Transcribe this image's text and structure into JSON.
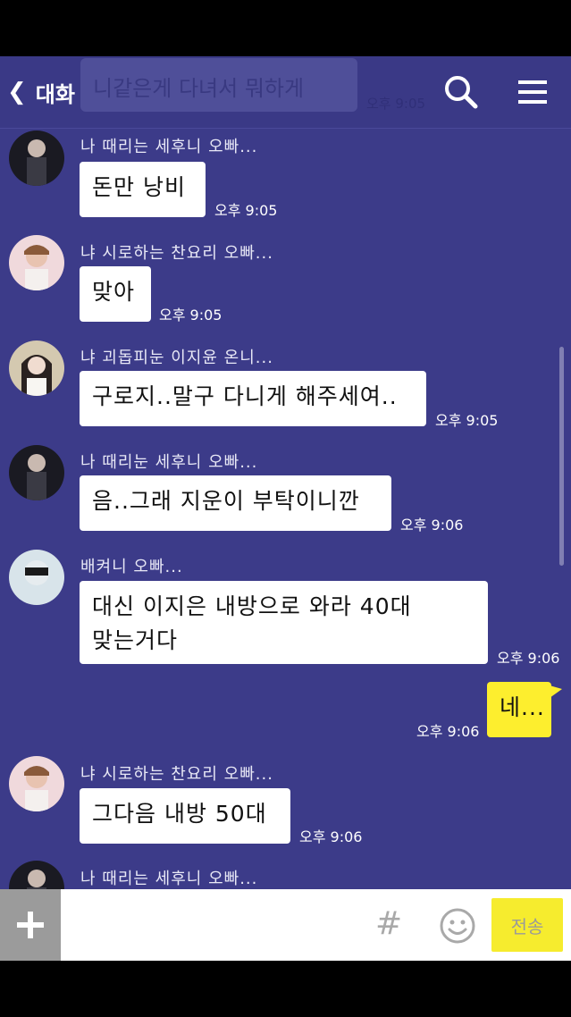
{
  "header": {
    "back_label": "대화",
    "notice_text": "니같은게 다녀서 뭐하게",
    "notice_time": "오후 9:05"
  },
  "messages": [
    {
      "sender": "나 때리는 세후니 오빠...",
      "text": "돈만 낭비",
      "time": "오후 9:05"
    },
    {
      "sender": "냐 시로하는 찬요리 오빠...",
      "text": "맞아",
      "time": "오후 9:05"
    },
    {
      "sender": "냐 괴돕피눈 이지윤 온니...",
      "text": "구로지..말구 다니게 해주세여..",
      "time": "오후 9:05"
    },
    {
      "sender": "나 때리눈 세후니 오빠...",
      "text": "음..그래 지운이 부탁이니깐",
      "time": "오후 9:06"
    },
    {
      "sender": "배켜니 오빠...",
      "text": "대신 이지은 내방으로 와라 40대\n맞는거다",
      "time": "오후 9:06"
    },
    {
      "sender": "",
      "text": "네...",
      "time": "오후 9:06"
    },
    {
      "sender": "냐 시로하는 찬요리 오빠...",
      "text": "그다음 내방 50대",
      "time": "오후 9:06"
    },
    {
      "sender": "나 때리는 세후니 오빠...",
      "text": "",
      "time": ""
    }
  ],
  "input": {
    "placeholder": "",
    "hash_label": "#",
    "send_label": "전송"
  },
  "icons": {
    "back": "chevron-left-icon",
    "search": "search-icon",
    "menu": "menu-icon",
    "plus": "plus-icon",
    "hash": "hashtag-icon",
    "emoji": "emoji-icon"
  },
  "colors": {
    "background": "#3c3b89",
    "bubble_other": "#ffffff",
    "bubble_mine": "#fdee2e",
    "send_button": "#f6ec2e"
  }
}
